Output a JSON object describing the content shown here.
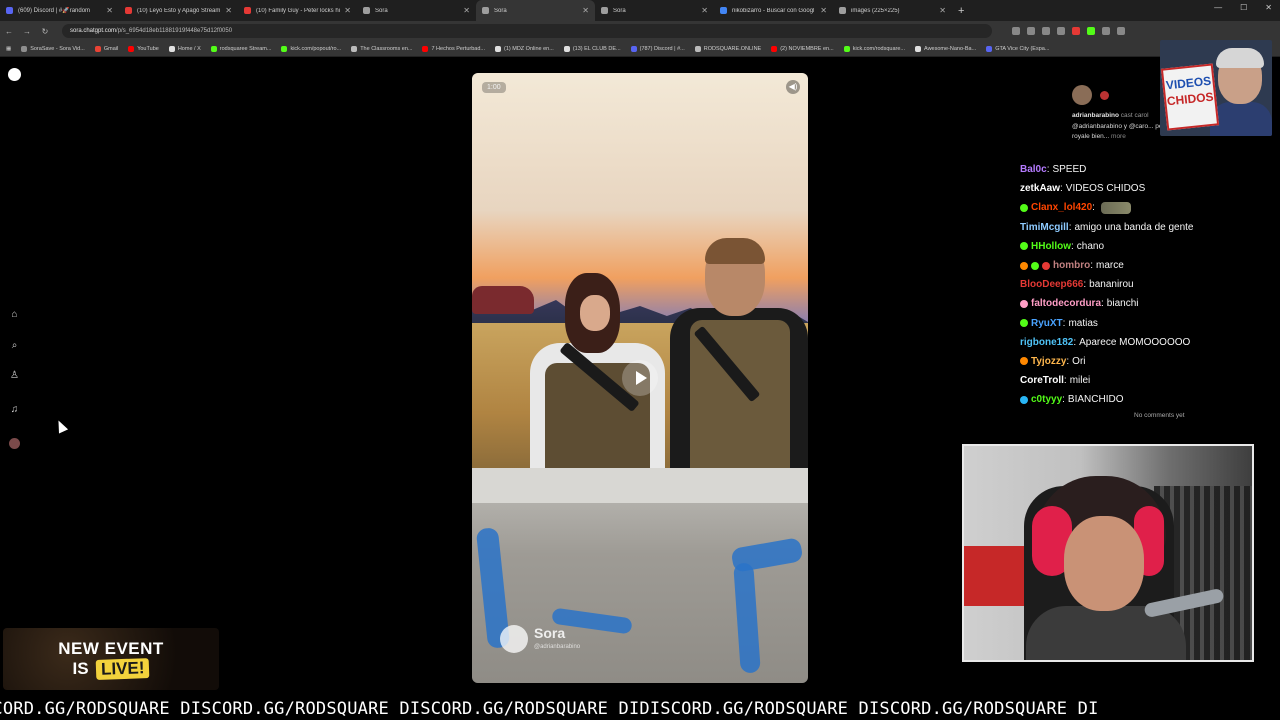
{
  "browser": {
    "tabs": [
      {
        "title": "(609) Discord | #🚀random",
        "color": "#5865f2",
        "active": false
      },
      {
        "title": "(10) Leyó Esto y Apagó Stream",
        "color": "#e53935",
        "active": false
      },
      {
        "title": "(10) Family Guy - Peter locks hi",
        "color": "#e53935",
        "active": false
      },
      {
        "title": "Sora",
        "color": "#9e9e9e",
        "active": false
      },
      {
        "title": "Sora",
        "color": "#9e9e9e",
        "active": true
      },
      {
        "title": "Sora",
        "color": "#9e9e9e",
        "active": false
      },
      {
        "title": "nikobizarro - Buscar con Googl",
        "color": "#4285f4",
        "active": false
      },
      {
        "title": "images (225×225)",
        "color": "#9e9e9e",
        "active": false
      }
    ],
    "new_tab": "+",
    "url_domain": "sora.chatgpt.com",
    "url_path": "/p/s_6954d18eb11881919f448e75d12f0050",
    "bookmarks": [
      {
        "label": "SoraSave - Sora Vid...",
        "color": "#8e8e8e"
      },
      {
        "label": "Gmail",
        "color": "#ea4335"
      },
      {
        "label": "YouTube",
        "color": "#ff0000"
      },
      {
        "label": "Home / X",
        "color": "#e0e0e0"
      },
      {
        "label": "rodsquaree Stream...",
        "color": "#53fc18"
      },
      {
        "label": "kick.com/popout/ro...",
        "color": "#53fc18"
      },
      {
        "label": "The Classrooms en...",
        "color": "#bbbbbb"
      },
      {
        "label": "7 Hechos Perturbad...",
        "color": "#ff0000"
      },
      {
        "label": "(1) MDZ Online en...",
        "color": "#e0e0e0"
      },
      {
        "label": "(13) EL CLUB DE...",
        "color": "#e0e0e0"
      },
      {
        "label": "(787) Discord | #...",
        "color": "#5865f2"
      },
      {
        "label": "RODSQUARE.ONLINE",
        "color": "#bbbbbb"
      },
      {
        "label": "(2) NOVIEMBRE en...",
        "color": "#ff0000"
      },
      {
        "label": "kick.com/rodsquare...",
        "color": "#53fc18"
      },
      {
        "label": "Awesome-Nano-Ba...",
        "color": "#e0e0e0"
      },
      {
        "label": "GTA Vice City (Espa...",
        "color": "#5865f2"
      }
    ]
  },
  "sora": {
    "sidebar_icons": [
      "home-icon",
      "search-icon",
      "trophy-icon",
      "bell-icon",
      "profile-avatar"
    ],
    "video": {
      "time": "1:00",
      "watermark_title": "Sora",
      "watermark_handle": "@adrianbarabino"
    },
    "comment": {
      "username": "adrianbarabino",
      "text_after_name": "cast carol",
      "body": "@adrianbarabino y @caro... personajes de un juego tipo battle royale bien...",
      "more": "more"
    },
    "no_comments": "No comments yet"
  },
  "stream": {
    "webcam_sign": [
      "VIDEOS",
      "CHIDOS"
    ],
    "chat": [
      {
        "user": "Bal0c",
        "color": "#b57bff",
        "badges": [],
        "msg": "SPEED",
        "emote": false
      },
      {
        "user": "zetkAaw",
        "color": "#ffffff",
        "badges": [],
        "msg": "VIDEOS CHIDOS",
        "emote": false
      },
      {
        "user": "Clanx_lol420",
        "color": "#ff4500",
        "badges": [
          "#53fc18"
        ],
        "msg": "",
        "emote": true
      },
      {
        "user": "TimiMcgill",
        "color": "#8ecbff",
        "badges": [],
        "msg": "amigo una banda de gente",
        "emote": false
      },
      {
        "user": "HHollow",
        "color": "#53fc18",
        "badges": [
          "#53fc18"
        ],
        "msg": "chano",
        "emote": false
      },
      {
        "user": "hombro",
        "color": "#c08080",
        "badges": [
          "#ff8800",
          "#53fc18",
          "#e53935"
        ],
        "msg": "marce",
        "emote": false
      },
      {
        "user": "BlooDeep666",
        "color": "#e53935",
        "badges": [],
        "msg": "bananirou",
        "emote": false
      },
      {
        "user": "faltodecordura",
        "color": "#ff9ec6",
        "badges": [
          "#ff9ec6"
        ],
        "msg": "bianchi",
        "emote": false
      },
      {
        "user": "RyuXT",
        "color": "#4aa3ff",
        "badges": [
          "#53fc18"
        ],
        "msg": "matias",
        "emote": false
      },
      {
        "user": "rigbone182",
        "color": "#4fc3f7",
        "badges": [],
        "msg": "Aparece MOMOOOOOO",
        "emote": false
      },
      {
        "user": "Tyjozzy",
        "color": "#ffb74d",
        "badges": [
          "#ff8800"
        ],
        "msg": "Ori",
        "emote": false
      },
      {
        "user": "CoreTroll",
        "color": "#ffffff",
        "badges": [],
        "msg": "milei",
        "emote": false
      },
      {
        "user": "c0tyyy",
        "color": "#53fc18",
        "badges": [
          "#29b6f6"
        ],
        "msg": "BIANCHIDO",
        "emote": false
      }
    ],
    "event_line1": "NEW EVENT",
    "event_is": "IS",
    "event_live": "LIVE!",
    "ticker": "SCORD.GG/RODSQUARE DISCORD.GG/RODSQUARE DISCORD.GG/RODSQUARE DIDISCORD.GG/RODSQUARE DISCORD.GG/RODSQUARE DI"
  }
}
